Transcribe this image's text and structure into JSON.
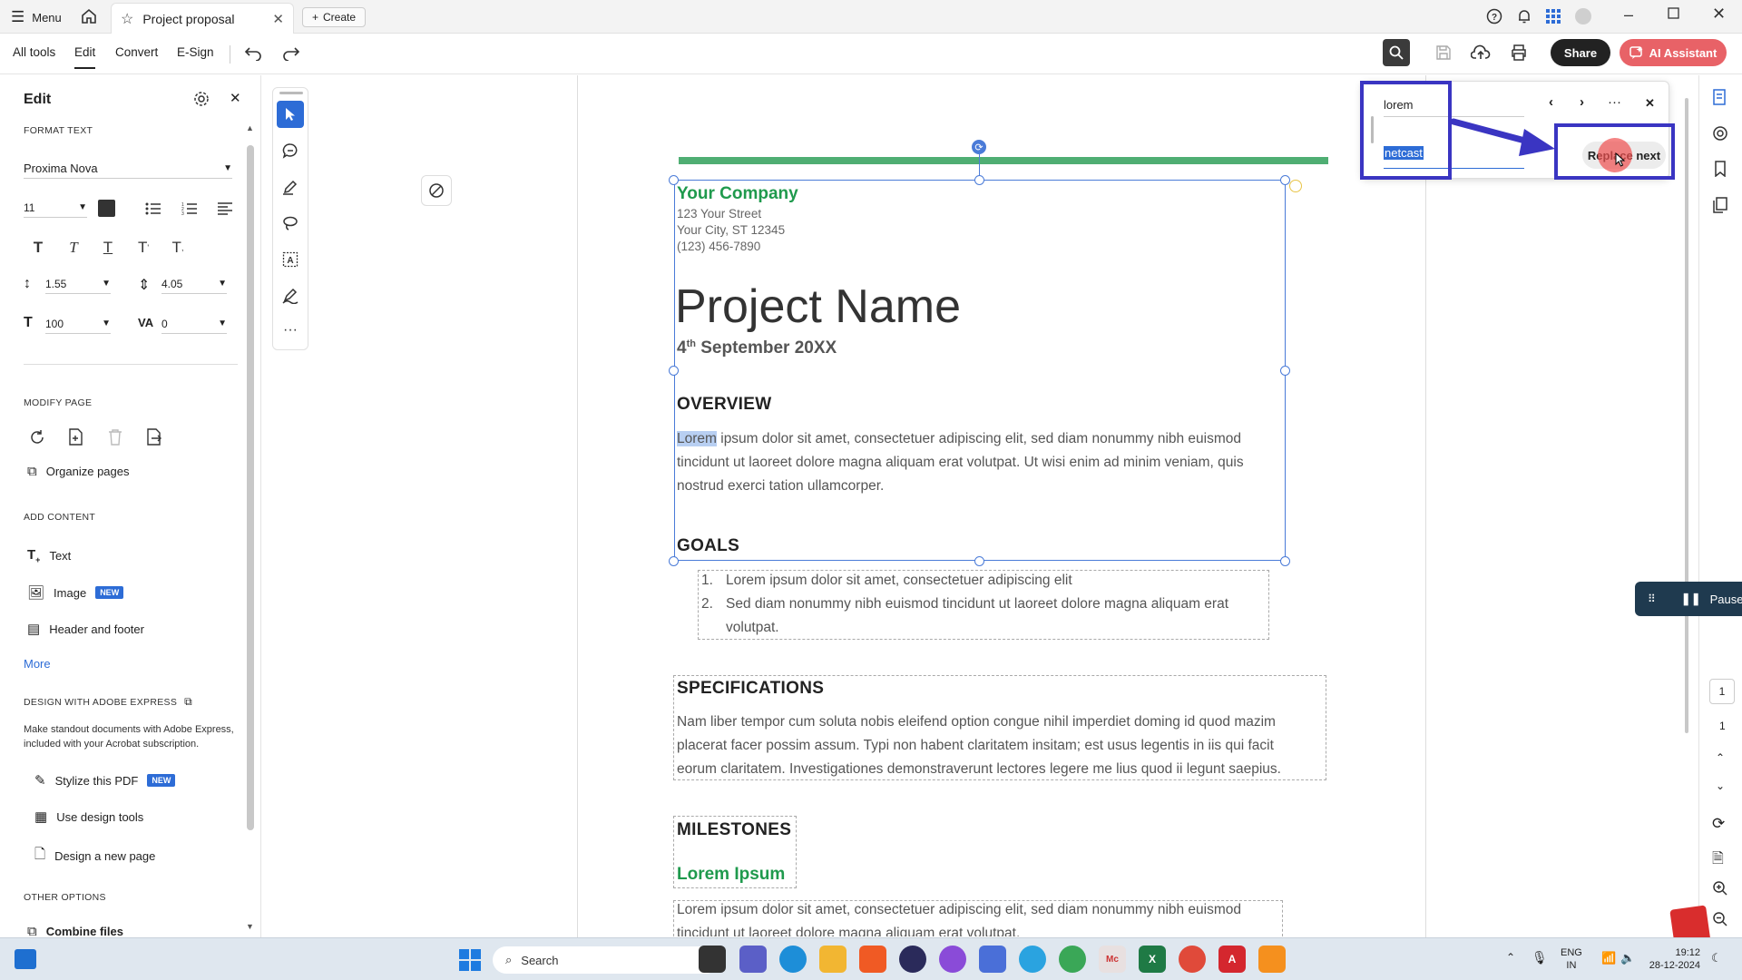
{
  "titlebar": {
    "menu_label": "Menu",
    "tab_title": "Project proposal",
    "create_label": "Create"
  },
  "toolbar": {
    "tabs": [
      "All tools",
      "Edit",
      "Convert",
      "E-Sign"
    ],
    "share_label": "Share",
    "ai_label": "AI Assistant"
  },
  "left_panel": {
    "title": "Edit",
    "format_text": "FORMAT TEXT",
    "font": "Proxima Nova",
    "font_size": "11",
    "line_spacing": "1.55",
    "para_spacing": "4.05",
    "h_scale": "100",
    "char_spacing": "0",
    "modify_page": "MODIFY PAGE",
    "organize_pages": "Organize pages",
    "add_content": "ADD CONTENT",
    "add_text": "Text",
    "add_image": "Image",
    "new_badge": "NEW",
    "header_footer": "Header and footer",
    "more": "More",
    "design_head": "DESIGN WITH ADOBE EXPRESS",
    "design_desc": "Make standout documents with Adobe Express, included with your Acrobat subscription.",
    "stylize": "Stylize this PDF",
    "design_tools": "Use design tools",
    "design_page": "Design a new page",
    "other_options": "OTHER OPTIONS",
    "combine": "Combine files"
  },
  "find_replace": {
    "find_value": "lorem",
    "replace_value": "netcast",
    "replace_next_label": "Replace next"
  },
  "document": {
    "company": "Your Company",
    "street": "123 Your Street",
    "city": "Your City, ST 12345",
    "phone": "(123) 456-7890",
    "project_name": "Project Name",
    "date_day": "4",
    "date_sup": "th",
    "date_rest": " September 20XX",
    "overview_head": "OVERVIEW",
    "overview_highlight": "Lorem",
    "overview_line1": " ipsum dolor sit amet, consectetuer adipiscing elit, sed diam nonummy nibh euismod",
    "overview_line2": "tincidunt ut laoreet dolore magna aliquam erat volutpat. Ut wisi enim ad minim veniam, quis",
    "overview_line3": "nostrud exerci tation ullamcorper.",
    "goals_head": "GOALS",
    "goal1_num": "1.",
    "goal1": "Lorem ipsum dolor sit amet, consectetuer adipiscing elit",
    "goal2_num": "2.",
    "goal2_line1": "Sed diam nonummy nibh euismod tincidunt ut laoreet dolore magna aliquam erat",
    "goal2_line2": "volutpat.",
    "spec_head": "SPECIFICATIONS",
    "spec_line1": "Nam liber tempor cum soluta nobis eleifend option congue nihil imperdiet doming id quod mazim",
    "spec_line2": "placerat facer possim assum. Typi non habent claritatem insitam; est usus legentis in iis qui facit",
    "spec_line3": "eorum claritatem. Investigationes demonstraverunt lectores legere me lius quod ii legunt saepius.",
    "milestones_head": "MILESTONES",
    "lorem_ipsum_head": "Lorem Ipsum",
    "ms_line1": "Lorem ipsum dolor sit amet, consectetuer adipiscing elit, sed diam nonummy nibh euismod",
    "ms_line2": "tincidunt ut laoreet dolore magna aliquam erat volutpat."
  },
  "right_rail": {
    "pause_label": "Pause",
    "page_current": "1",
    "page_total": "1"
  },
  "taskbar": {
    "search_placeholder": "Search",
    "lang_top": "ENG",
    "lang_bottom": "IN",
    "time": "19:12",
    "date": "28-12-2024"
  },
  "colors": {
    "accent_blue": "#2d6cd6",
    "annotation_purple": "#3a35c2",
    "doc_green": "#1f9a4d",
    "ai_button": "#e86267"
  }
}
